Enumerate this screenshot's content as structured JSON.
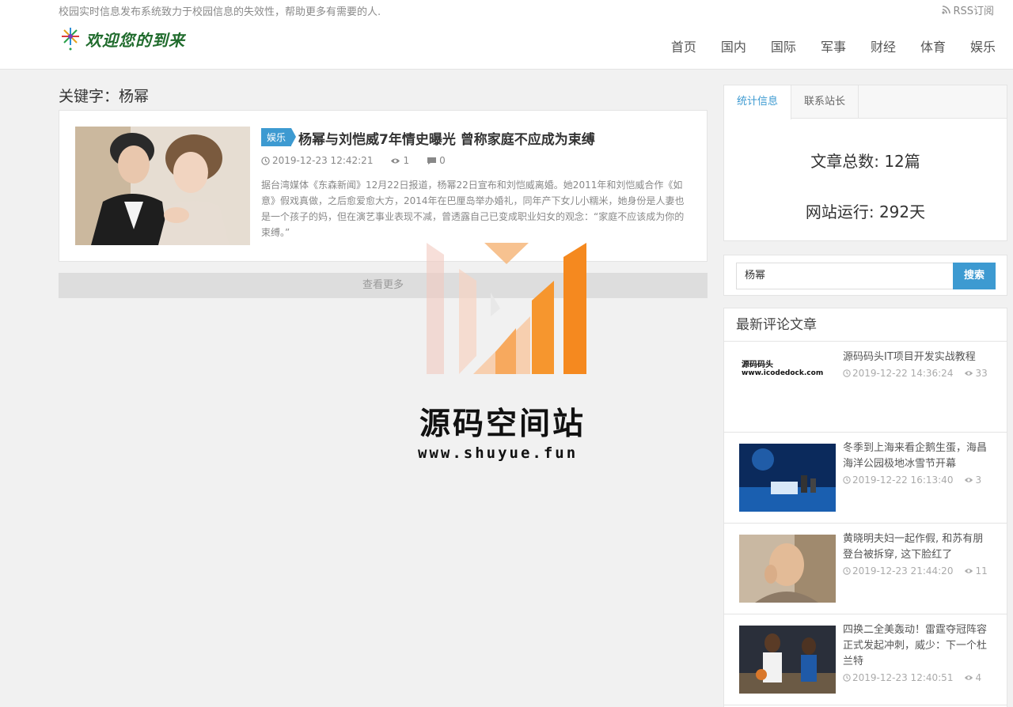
{
  "header": {
    "slogan": "校园实时信息发布系统致力于校园信息的失效性，帮助更多有需要的人.",
    "rss": "RSS订阅",
    "logo_text": "欢迎您的到来",
    "nav": [
      "首页",
      "国内",
      "国际",
      "军事",
      "财经",
      "体育",
      "娱乐"
    ]
  },
  "main": {
    "keyword_title": "关键字：杨幂",
    "article": {
      "category": "娱乐",
      "title": "杨幂与刘恺威7年情史曝光 曾称家庭不应成为束缚",
      "datetime": "2019-12-23 12:42:21",
      "views": "1",
      "comments": "0",
      "excerpt": "据台湾媒体《东森新闻》12月22日报道，杨幂22日宣布和刘恺威离婚。她2011年和刘恺威合作《如意》假戏真做，之后愈爱愈大方，2014年在巴厘岛举办婚礼，同年产下女儿小糯米，她身份是人妻也是一个孩子的妈，但在演艺事业表现不减，曾透露自己已变成职业妇女的观念：“家庭不应该成为你的束缚。”"
    },
    "more_label": "查看更多"
  },
  "sidebar": {
    "tabs": [
      "统计信息",
      "联系站长"
    ],
    "stats": {
      "total": "文章总数: 12篇",
      "uptime": "网站运行: 292天"
    },
    "search": {
      "value": "杨幂",
      "button": "搜索"
    },
    "latest": {
      "heading": "最新评论文章",
      "items": [
        {
          "title": "源码码头IT项目开发实战教程",
          "datetime": "2019-12-22 14:36:24",
          "views": "33",
          "thumb_line1": "源码码头",
          "thumb_line2": "www.icodedock.com"
        },
        {
          "title": "冬季到上海来看企鹅生蛋，海昌海洋公园极地冰雪节开幕",
          "datetime": "2019-12-22 16:13:40",
          "views": "3"
        },
        {
          "title": "黄晓明夫妇一起作假, 和苏有朋登台被拆穿, 这下脸红了",
          "datetime": "2019-12-23 21:44:20",
          "views": "11"
        },
        {
          "title": "四换二全美轰动！雷霆夺冠阵容正式发起冲刺，威少：下一个杜兰特",
          "datetime": "2019-12-23 12:40:51",
          "views": "4"
        }
      ]
    }
  },
  "watermark": {
    "title": "源码空间站",
    "url": "www.shuyue.fun"
  },
  "colors": {
    "accent": "#3d9ad1",
    "watermark_orange": "#f5891f"
  }
}
